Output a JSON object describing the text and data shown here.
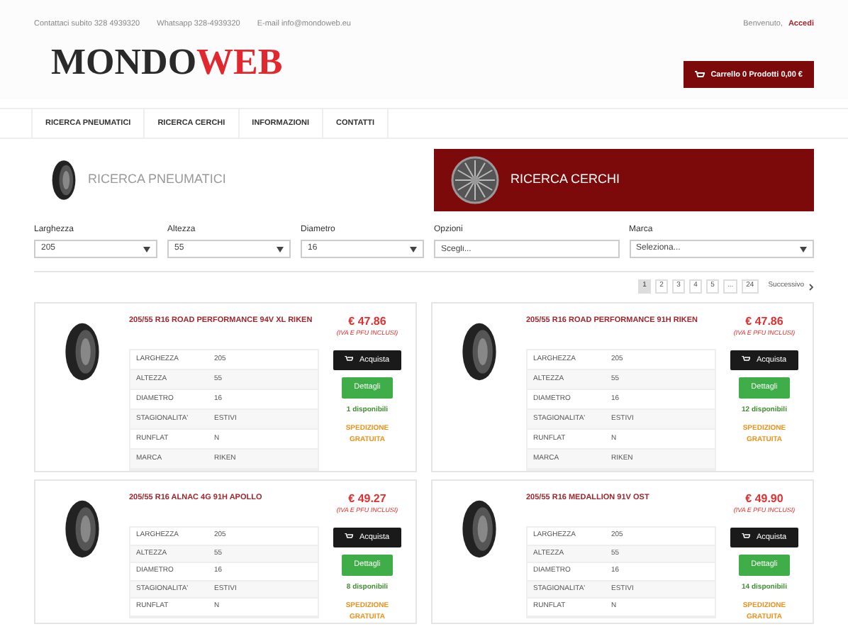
{
  "topbar": {
    "phone": "Contattaci subito 328 4939320",
    "whatsapp": "Whatsapp 328-4939320",
    "email": "E-mail info@mondoweb.eu",
    "welcome": "Benvenuto,",
    "login": "Accedi"
  },
  "logo": {
    "part1": "MONDO",
    "part2": "WEB"
  },
  "cart": {
    "label": "Carrello 0 Prodotti 0,00 €"
  },
  "nav": [
    {
      "label": "RICERCA PNEUMATICI",
      "selected": false
    },
    {
      "label": "RICERCA CERCHI",
      "selected": false
    },
    {
      "label": "INFORMAZIONI",
      "selected": false
    },
    {
      "label": "CONTATTI",
      "selected": false
    }
  ],
  "search_tabs": [
    {
      "label": "RICERCA PNEUMATICI",
      "kind": "tire",
      "selected": false
    },
    {
      "label": "RICERCA CERCHI",
      "kind": "rim",
      "selected": true
    }
  ],
  "filters": [
    {
      "label": "Larghezza",
      "kind": "select",
      "value": "205"
    },
    {
      "label": "Altezza",
      "kind": "select",
      "value": "55"
    },
    {
      "label": "Diametro",
      "kind": "select",
      "value": "16"
    },
    {
      "label": "Opzioni",
      "kind": "input",
      "placeholder": "Scegli..."
    },
    {
      "label": "Marca",
      "kind": "select",
      "value": "Seleziona..."
    }
  ],
  "pagination": {
    "pages": [
      {
        "label": "1",
        "selected": true
      },
      {
        "label": "2",
        "selected": false
      },
      {
        "label": "3",
        "selected": false
      },
      {
        "label": "4",
        "selected": false
      },
      {
        "label": "5",
        "selected": false
      },
      {
        "label": "...",
        "selected": false
      },
      {
        "label": "24",
        "selected": false
      }
    ],
    "next": "Successivo"
  },
  "products": [
    {
      "title": "205/55 R16 ROAD PERFORMANCE 94V XL RIKEN",
      "price": "€ 47.86",
      "price_note": "(IVA E PFU INCLUSI)",
      "buy": "Acquista",
      "details": "Dettagli",
      "stock": "1 disponibili",
      "shipping": "SPEDIZIONE GRATUITA",
      "specs": [
        {
          "name": "LARGHEZZA",
          "value": "205"
        },
        {
          "name": "ALTEZZA",
          "value": "55"
        },
        {
          "name": "DIAMETRO",
          "value": "16"
        },
        {
          "name": "STAGIONALITA'",
          "value": "ESTIVI"
        },
        {
          "name": "RUNFLAT",
          "value": "N"
        },
        {
          "name": "MARCA",
          "value": "RIKEN"
        }
      ]
    },
    {
      "title": "205/55 R16 ROAD PERFORMANCE 91H RIKEN",
      "price": "€ 47.86",
      "price_note": "(IVA E PFU INCLUSI)",
      "buy": "Acquista",
      "details": "Dettagli",
      "stock": "12 disponibili",
      "shipping": "SPEDIZIONE GRATUITA",
      "specs": [
        {
          "name": "LARGHEZZA",
          "value": "205"
        },
        {
          "name": "ALTEZZA",
          "value": "55"
        },
        {
          "name": "DIAMETRO",
          "value": "16"
        },
        {
          "name": "STAGIONALITA'",
          "value": "ESTIVI"
        },
        {
          "name": "RUNFLAT",
          "value": "N"
        },
        {
          "name": "MARCA",
          "value": "RIKEN"
        }
      ]
    },
    {
      "title": "205/55 R16 ALNAC 4G 91H APOLLO",
      "price": "€ 49.27",
      "price_note": "(IVA E PFU INCLUSI)",
      "buy": "Acquista",
      "details": "Dettagli",
      "stock": "8 disponibili",
      "shipping": "SPEDIZIONE GRATUITA",
      "specs": [
        {
          "name": "LARGHEZZA",
          "value": "205"
        },
        {
          "name": "ALTEZZA",
          "value": "55"
        },
        {
          "name": "DIAMETRO",
          "value": "16"
        },
        {
          "name": "STAGIONALITA'",
          "value": "ESTIVI"
        },
        {
          "name": "RUNFLAT",
          "value": "N"
        }
      ]
    },
    {
      "title": "205/55 R16 MEDALLION 91V OST",
      "price": "€ 49.90",
      "price_note": "(IVA E PFU INCLUSI)",
      "buy": "Acquista",
      "details": "Dettagli",
      "stock": "14 disponibili",
      "shipping": "SPEDIZIONE GRATUITA",
      "specs": [
        {
          "name": "LARGHEZZA",
          "value": "205"
        },
        {
          "name": "ALTEZZA",
          "value": "55"
        },
        {
          "name": "DIAMETRO",
          "value": "16"
        },
        {
          "name": "STAGIONALITA'",
          "value": "ESTIVI"
        },
        {
          "name": "RUNFLAT",
          "value": "N"
        }
      ]
    }
  ]
}
